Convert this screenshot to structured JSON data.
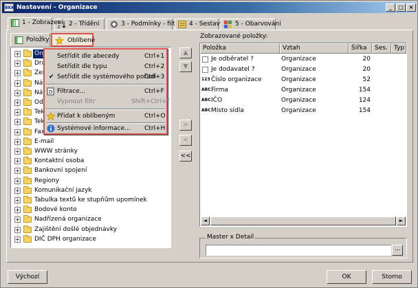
{
  "window": {
    "app_icon_text": "BKK",
    "title": "Nastavení - Organizace"
  },
  "tabs": [
    {
      "label": "1 - Zobrazení"
    },
    {
      "label": "2 - Třídění"
    },
    {
      "label": "3 - Podmínky - filtr"
    },
    {
      "label": "4 - Sestavy"
    },
    {
      "label": "5 - Obarvování"
    }
  ],
  "left": {
    "subtabs": [
      {
        "label": "Položky"
      },
      {
        "label": "Oblíbené"
      }
    ],
    "tree": [
      {
        "label": "Organizace"
      },
      {
        "label": "Drub"
      },
      {
        "label": "Zeme"
      },
      {
        "label": "Náv"
      },
      {
        "label": "Náv"
      },
      {
        "label": "Odp"
      },
      {
        "label": "Tek"
      },
      {
        "label": "Tek"
      },
      {
        "label": "Fax"
      },
      {
        "label": "E-mail"
      },
      {
        "label": "WWW stránky"
      },
      {
        "label": "Kontaktní osoba"
      },
      {
        "label": "Bankovní spojení"
      },
      {
        "label": "Regiony"
      },
      {
        "label": "Komunikační jazyk"
      },
      {
        "label": "Tabulka textů ke stupňům upomínek"
      },
      {
        "label": "Bodové konto"
      },
      {
        "label": "Nadřízená organizace"
      },
      {
        "label": "Zajištění došlé objednávky"
      },
      {
        "label": "DIČ DPH organizace"
      }
    ]
  },
  "context_menu": {
    "items": [
      {
        "label": "Setřídit dle abecedy",
        "shortcut": "Ctrl+1"
      },
      {
        "label": "Setřídit dle typu",
        "shortcut": "Ctrl+2"
      },
      {
        "label": "Setřídit dle systémového pořadí",
        "shortcut": "Ctrl+3"
      },
      {
        "label": "Filtrace...",
        "shortcut": "Ctrl+F"
      },
      {
        "label": "Vypnout filtr",
        "shortcut": "Shift+Ctrl+F"
      },
      {
        "label": "Přidat k oblíbeným",
        "shortcut": "Ctrl+O"
      },
      {
        "label": "Systémové informace...",
        "shortcut": "Ctrl+H"
      }
    ]
  },
  "right": {
    "label": "Zobrazované položky:",
    "columns": [
      "Položka",
      "Vztah",
      "Šířka",
      "Ses.",
      "Typ"
    ],
    "rows": [
      {
        "type": "check",
        "name": "Je odběratel ?",
        "relation": "Organizace",
        "width": "20"
      },
      {
        "type": "check",
        "name": "Je dodavatel ?",
        "relation": "Organizace",
        "width": "20"
      },
      {
        "type": "num",
        "type_label": "123",
        "name": "Číslo organizace",
        "relation": "Organizace",
        "width": "52"
      },
      {
        "type": "abc",
        "type_label": "ABC",
        "name": "Firma",
        "relation": "Organizace",
        "width": "154"
      },
      {
        "type": "abc",
        "type_label": "ABC",
        "name": "IČO",
        "relation": "Organizace",
        "width": "124"
      },
      {
        "type": "abc",
        "type_label": "ABC",
        "name": "Místo sídla",
        "relation": "Organizace",
        "width": "154"
      }
    ],
    "master_detail_label": "Master x Detail",
    "master_detail_value": "",
    "ellipsis": "..."
  },
  "buttons": {
    "default_label": "Výchozí",
    "ok_label": "OK",
    "cancel_label": "Storno"
  },
  "colors": {
    "highlight_border": "#d9534f",
    "selection": "#0a246a"
  }
}
